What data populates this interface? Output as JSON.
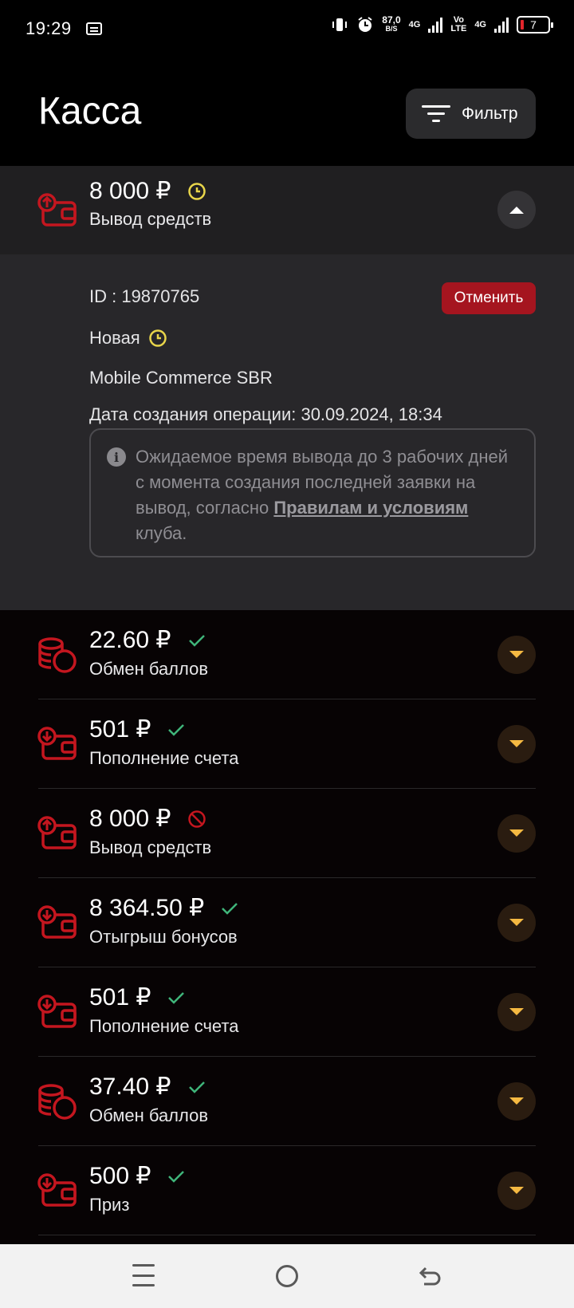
{
  "status_bar": {
    "time": "19:29",
    "rate_value": "87,0",
    "rate_unit": "B/S",
    "net1": "4G",
    "net2_top": "Vo",
    "net2_bottom": "LTE",
    "net3": "4G",
    "battery": "7"
  },
  "header": {
    "title": "Касса",
    "filter_label": "Фильтр"
  },
  "expanded": {
    "amount": "8 000 ₽",
    "type": "Вывод средств",
    "status_icon": "clock-icon",
    "id_text": "ID : 19870765",
    "cancel_label": "Отменить",
    "status_text": "Новая",
    "method": "Mobile Commerce SBR",
    "created": "Дата создания операции: 30.09.2024, 18:34",
    "note_before": "Ожидаемое время вывода до 3 рабочих дней с момента создания последней заявки на вывод, согласно ",
    "note_link": "Правилам и условиям",
    "note_after": " клуба."
  },
  "transactions": [
    {
      "amount": "22.60 ₽",
      "type": "Обмен баллов",
      "icon": "coins-icon",
      "status": "success"
    },
    {
      "amount": "501 ₽",
      "type": "Пополнение счета",
      "icon": "wallet-deposit-icon",
      "status": "success"
    },
    {
      "amount": "8 000 ₽",
      "type": "Вывод средств",
      "icon": "wallet-withdraw-icon",
      "status": "cancelled"
    },
    {
      "amount": "8 364.50 ₽",
      "type": "Отыгрыш бонусов",
      "icon": "wallet-deposit-icon",
      "status": "success"
    },
    {
      "amount": "501 ₽",
      "type": "Пополнение счета",
      "icon": "wallet-deposit-icon",
      "status": "success"
    },
    {
      "amount": "37.40 ₽",
      "type": "Обмен баллов",
      "icon": "coins-icon",
      "status": "success"
    },
    {
      "amount": "500 ₽",
      "type": "Приз",
      "icon": "wallet-deposit-icon",
      "status": "success"
    }
  ],
  "colors": {
    "accent_red": "#c4161f",
    "success_green": "#3fb57a",
    "pending_yellow": "#e8d54a",
    "chevron_gold": "#f5b942"
  }
}
